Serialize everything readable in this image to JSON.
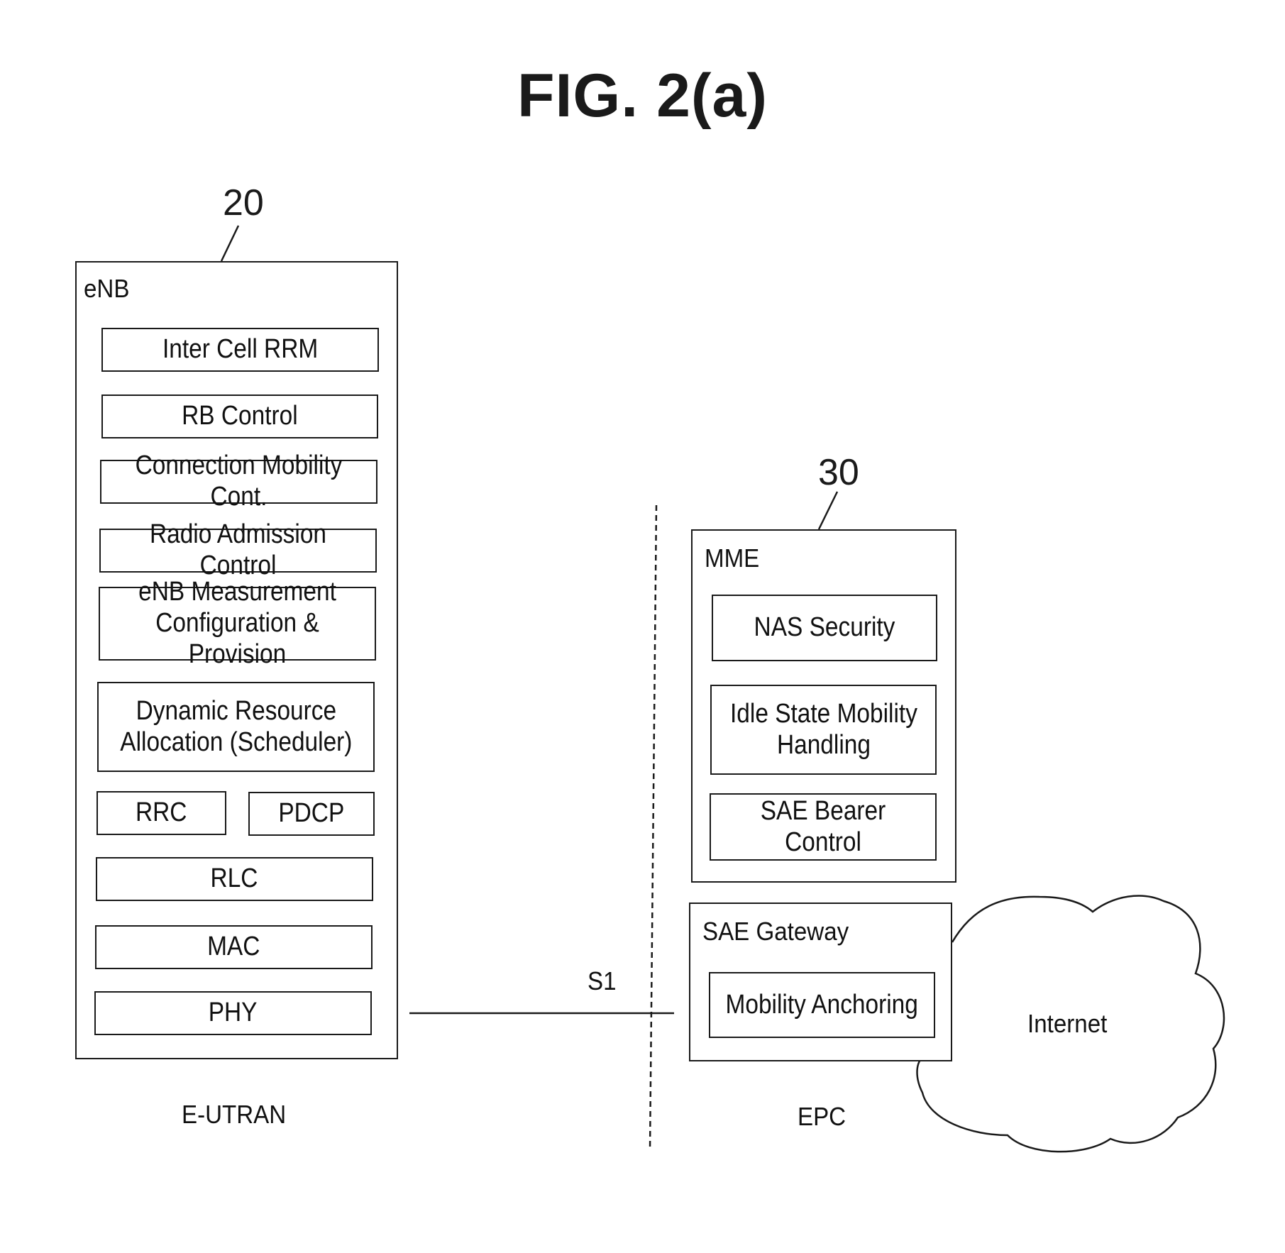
{
  "figure": {
    "title": "FIG. 2(a)"
  },
  "enb": {
    "ref_number": "20",
    "label": "eNB",
    "functions": {
      "inter_cell_rrm": "Inter Cell RRM",
      "rb_control": "RB  Control",
      "connection_mobility": "Connection Mobility Cont.",
      "radio_admission": "Radio Admission Control",
      "measurement": "eNB Measurement\nConfiguration & Provision",
      "scheduler": "Dynamic Resource\nAllocation (Scheduler)",
      "rrc": "RRC",
      "pdcp": "PDCP",
      "rlc": "RLC",
      "mac": "MAC",
      "phy": "PHY"
    },
    "caption": "E-UTRAN"
  },
  "interface": {
    "label": "S1"
  },
  "epc": {
    "ref_number": "30",
    "caption": "EPC",
    "mme": {
      "label": "MME",
      "functions": {
        "nas_security": "NAS  Security",
        "idle_mobility": "Idle State Mobility\nHandling",
        "sae_bearer": "SAE Bearer Control"
      }
    },
    "sae_gateway": {
      "label": "SAE Gateway",
      "functions": {
        "mobility_anchoring": "Mobility Anchoring"
      }
    }
  },
  "internet": {
    "label": "Internet"
  }
}
